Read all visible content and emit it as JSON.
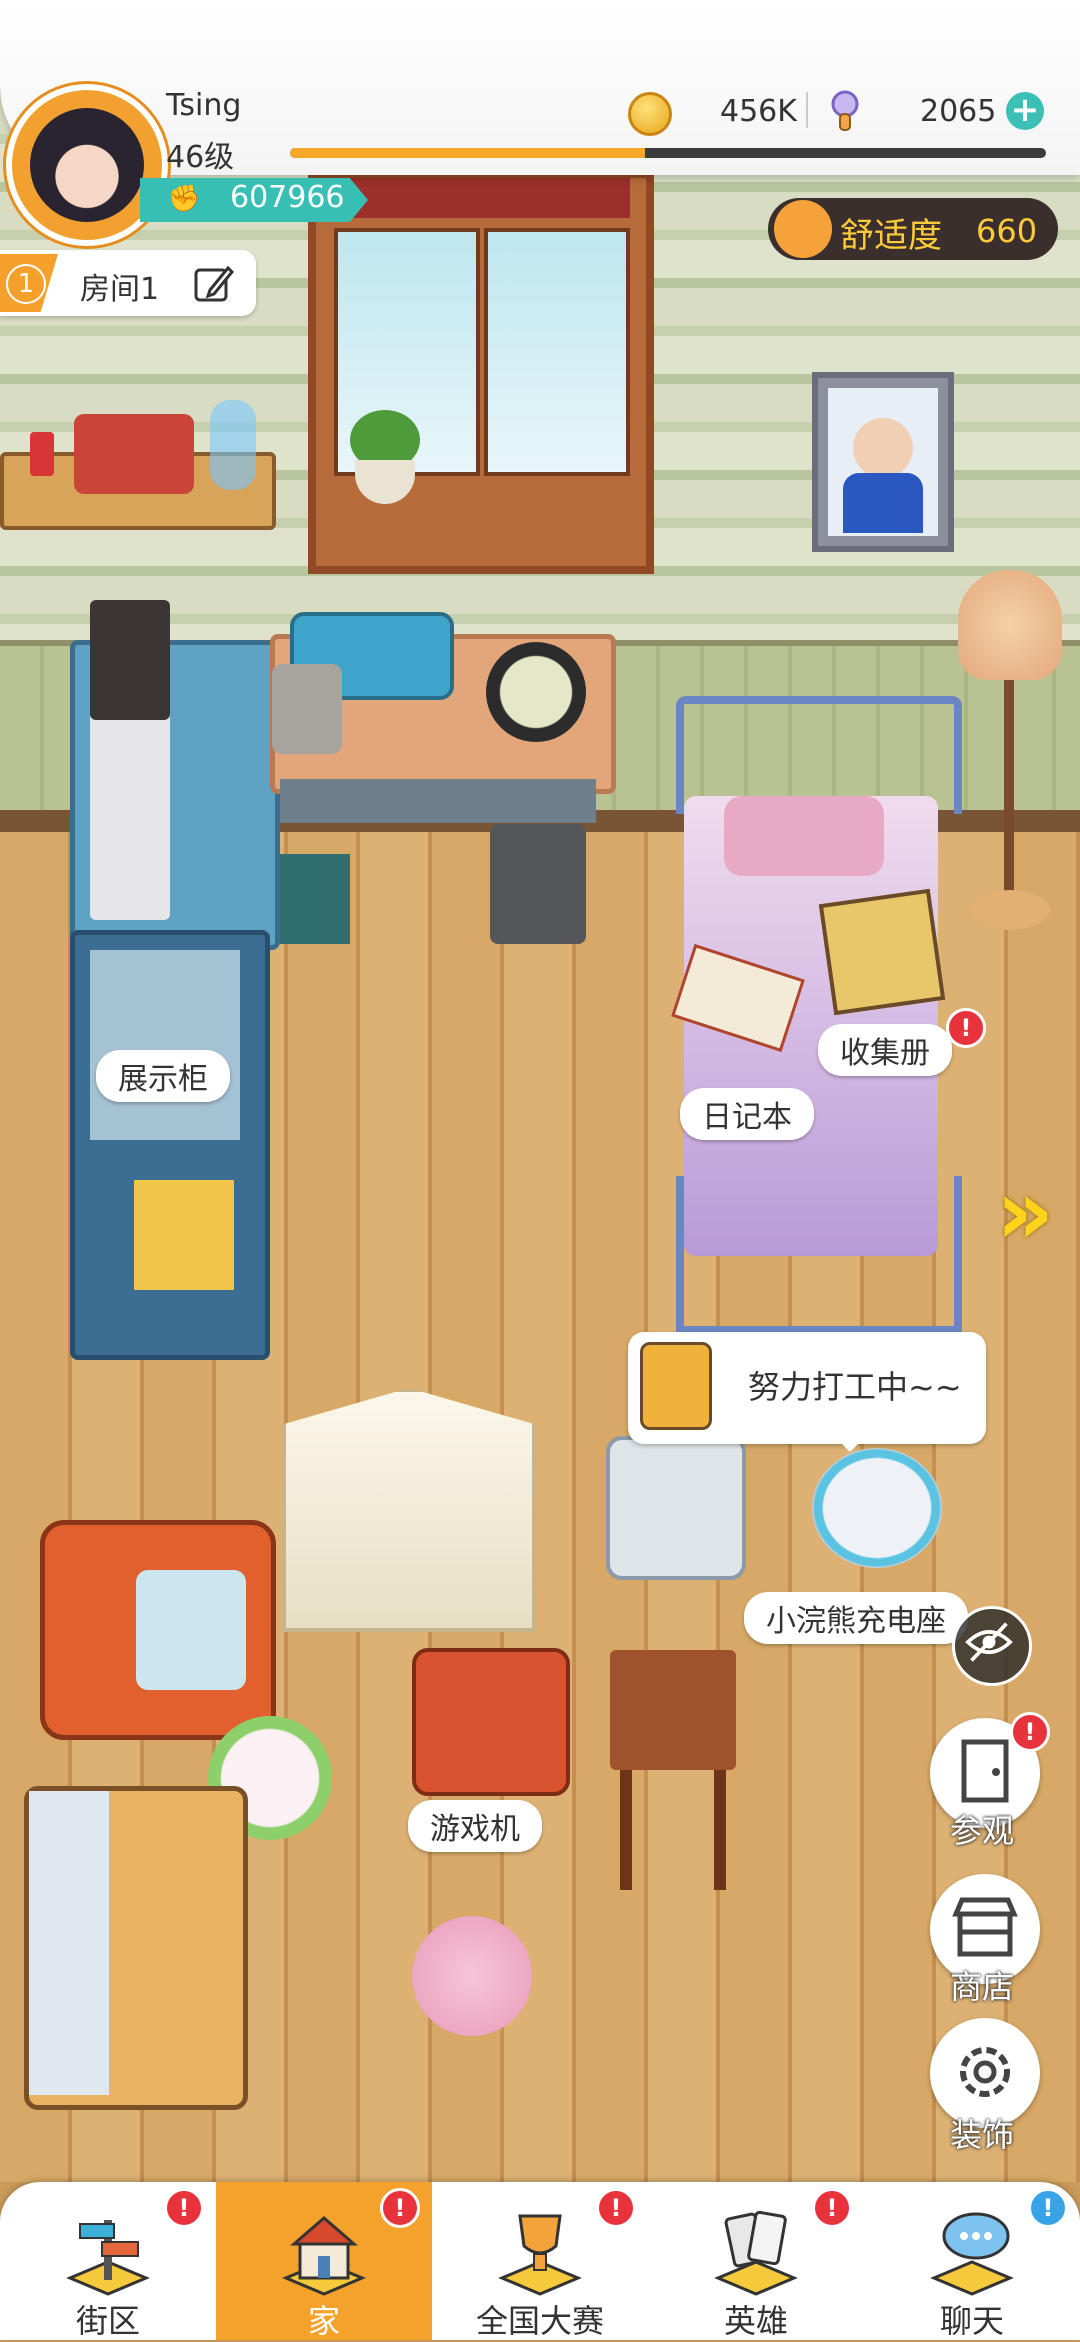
{
  "player": {
    "name": "Tsing",
    "level": "46级",
    "xp_progress": 0.47,
    "power": "607966"
  },
  "currency": {
    "coins": "456K",
    "gems": "2065"
  },
  "comfort": {
    "label": "舒适度",
    "value": "660"
  },
  "room": {
    "number": "1",
    "label": "房间1"
  },
  "furniture_labels": {
    "display_cabinet": "展示柜",
    "collection_book": "收集册",
    "diary": "日记本",
    "charging_dock": "小浣熊充电座",
    "game_console": "游戏机"
  },
  "speech": {
    "text": "努力打工中~~"
  },
  "side_buttons": {
    "visit": "参观",
    "shop": "商店",
    "decorate": "装饰"
  },
  "badge_mark": "!",
  "nav": {
    "items": [
      {
        "label": "街区",
        "badge": "!",
        "badge_color": "#e8323c"
      },
      {
        "label": "家",
        "badge": "!",
        "badge_color": "#e8323c"
      },
      {
        "label": "全国大赛",
        "badge": "!",
        "badge_color": "#e8323c"
      },
      {
        "label": "英雄",
        "badge": "!",
        "badge_color": "#e8323c"
      },
      {
        "label": "聊天",
        "badge": "!",
        "badge_color": "#3aa3e8"
      }
    ],
    "active_index": 1
  },
  "colors": {
    "accent_orange": "#f5a22d",
    "teal": "#38bfb4",
    "badge_red": "#e8323c",
    "comfort_gold": "#ffcb3a"
  }
}
